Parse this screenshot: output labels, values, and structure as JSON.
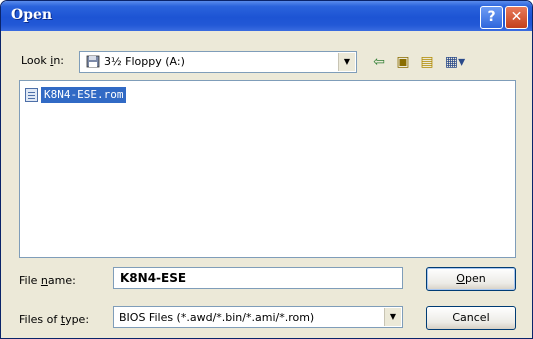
{
  "window": {
    "title": "Open",
    "help_glyph": "?",
    "close_glyph": "✕"
  },
  "lookin": {
    "label_prefix": "Look ",
    "label_accel": "i",
    "label_suffix": "n:",
    "value": "3½ Floppy (A:)"
  },
  "toolbar": {
    "back_glyph": "⇦",
    "up_glyph": "▣",
    "newfolder_glyph": "▤",
    "views_glyph": "▦▾"
  },
  "files": [
    {
      "name": "K8N4-ESE.rom"
    }
  ],
  "filename": {
    "label_prefix": "File ",
    "label_accel": "n",
    "label_suffix": "ame:",
    "value": "K8N4-ESE"
  },
  "filetype": {
    "label_prefix": "Files of ",
    "label_accel": "t",
    "label_suffix": "ype:",
    "value": "BIOS Files (*.awd/*.bin/*.ami/*.rom)"
  },
  "buttons": {
    "open_accel": "O",
    "open_rest": "pen",
    "cancel": "Cancel"
  },
  "icons": [
    "help-icon",
    "close-icon",
    "floppy-icon",
    "back-icon",
    "up-folder-icon",
    "new-folder-icon",
    "views-icon",
    "file-icon",
    "dropdown-arrow-icon"
  ]
}
